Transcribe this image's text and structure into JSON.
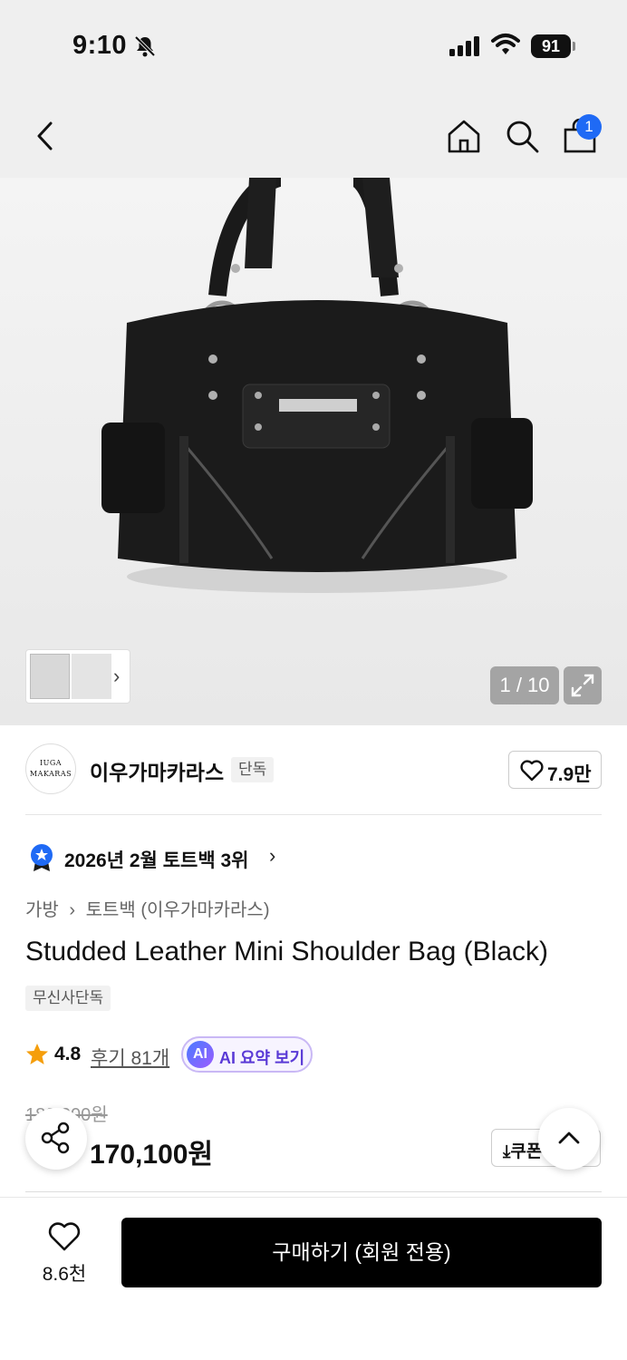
{
  "status_bar": {
    "time": "9:10",
    "battery": "91"
  },
  "header": {
    "cart_count": "1"
  },
  "gallery": {
    "page_indicator": "1 / 10"
  },
  "brand": {
    "logo_text_line1": "IUGA",
    "logo_text_line2": "MAKARAS",
    "name": "이우가마카라스",
    "tag": "단독",
    "like_count": "7.9만"
  },
  "ranking": {
    "text": "2026년 2월 토트백 3위"
  },
  "breadcrumb": {
    "category": "가방",
    "sub": "토트백 (이우가마카라스)"
  },
  "product": {
    "title": "Studded Leather Mini Shoulder Bag (Black)",
    "badge": "무신사단독",
    "rating": "4.8",
    "reviews": "후기 81개",
    "ai_icon": "AI",
    "ai_label": "AI 요약 보기",
    "original_price": "189,000원",
    "sale_price": "170,100원",
    "coupon_label": "쿠폰"
  },
  "bottom": {
    "wish_count": "8.6천",
    "buy_label": "구매하기 (회원 전용)"
  },
  "colors": {
    "accent_blue": "#1f6af5",
    "buy_button": "#000000",
    "star": "#f59e0b"
  }
}
